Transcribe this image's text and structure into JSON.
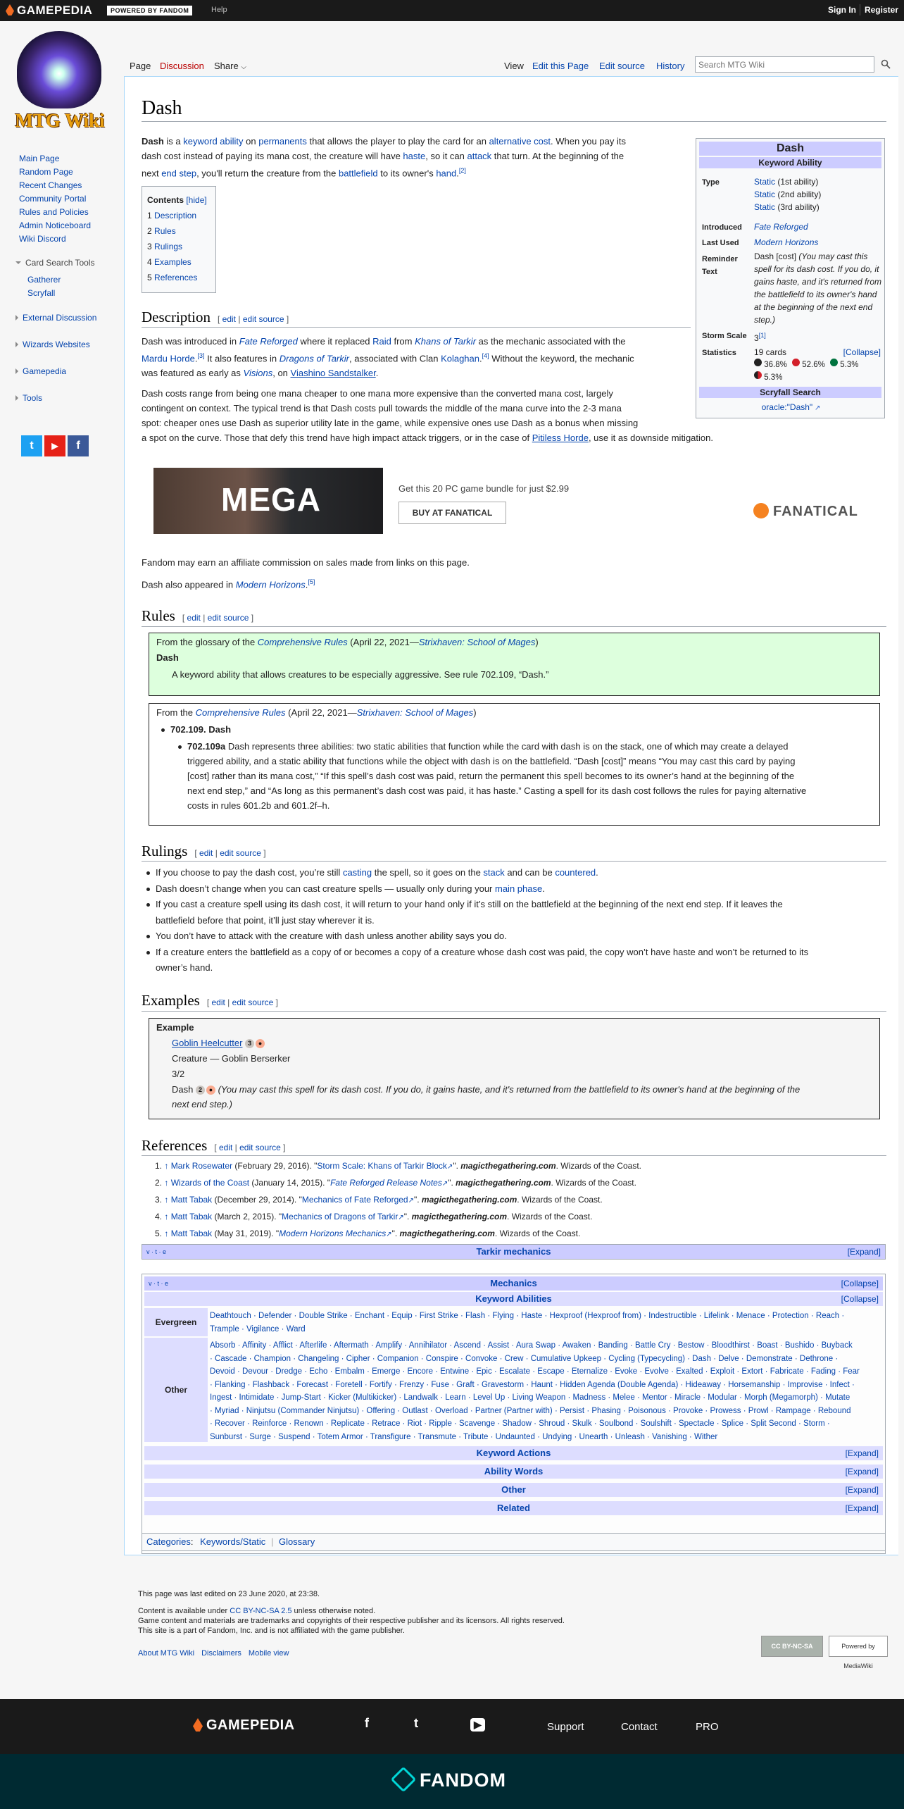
{
  "topbar": {
    "brand": "GAMEPEDIA",
    "powered": "POWERED BY FANDOM",
    "help": "Help",
    "signin": "Sign In",
    "register": "Register"
  },
  "logo": {
    "text": "MTG Wiki"
  },
  "sidebar": {
    "nav": [
      "Main Page",
      "Random Page",
      "Recent Changes",
      "Community Portal",
      "Rules and Policies",
      "Admin Noticeboard",
      "Wiki Discord"
    ],
    "card_search": {
      "title": "Card Search Tools",
      "items": [
        "Gatherer",
        "Scryfall"
      ]
    },
    "sections": [
      "External Discussion",
      "Wizards Websites",
      "Gamepedia",
      "Tools"
    ],
    "social": [
      "t",
      "▶",
      "f"
    ]
  },
  "tabs": {
    "page": "Page",
    "discussion": "Discussion",
    "share": "Share",
    "view": "View",
    "edit": "Edit this Page",
    "edit_source": "Edit source",
    "history": "History"
  },
  "search": {
    "placeholder": "Search MTG Wiki"
  },
  "title": "Dash",
  "intro": {
    "t1": "Dash",
    "t2": " is a ",
    "keyword_ability": "keyword ability",
    "t3": " on ",
    "permanents": "permanents",
    "t4": " that allows the player to play the card for an ",
    "alternative_cost": "alternative cost",
    "t5": ". When you pay its",
    "l2a": "dash cost instead of paying its mana cost, the creature will have ",
    "haste": "haste",
    "l2b": ", so it can ",
    "attack": "attack",
    "l2c": " that turn. At the beginning of the",
    "l3a": "next ",
    "end_step": "end step",
    "l3b": ", you'll return the creature from the ",
    "battlefield": "battlefield",
    "l3c": " to its owner's ",
    "hand": "hand",
    "l3d": ".",
    "ref2": "[2]"
  },
  "toc": {
    "title": "Contents",
    "hide": "[hide]",
    "items": [
      [
        "1",
        "Description"
      ],
      [
        "2",
        "Rules"
      ],
      [
        "3",
        "Rulings"
      ],
      [
        "4",
        "Examples"
      ],
      [
        "5",
        "References"
      ]
    ]
  },
  "edit_links": {
    "edit": "edit",
    "edit_source": "edit source",
    "sep": " | ",
    "open": "[ ",
    "close": " ]"
  },
  "infobox": {
    "title": "Dash",
    "subtitle": "Keyword Ability",
    "type_label": "Type",
    "types": [
      [
        "Static",
        " (1st ability)"
      ],
      [
        "Static",
        " (2nd ability)"
      ],
      [
        "Static",
        " (3rd ability)"
      ]
    ],
    "introduced_label": "Introduced",
    "introduced": "Fate Reforged",
    "last_used_label": "Last Used",
    "last_used": "Modern Horizons",
    "reminder_label": "Reminder",
    "reminder_label2": "Text",
    "reminder": "Dash [cost]",
    "reminder_italic": " (You may cast this spell for its dash cost. If you do, it gains haste, and it's returned from the battlefield to its owner's hand at the beginning of the next end step.)",
    "storm_label": "Storm Scale",
    "storm": "3",
    "storm_ref": "[1]",
    "stats_label": "Statistics",
    "stats_cards": "19 cards",
    "collapse": "[Collapse]",
    "stats": [
      {
        "color": "#222",
        "pct": "36.8%"
      },
      {
        "color": "#d3202a",
        "pct": "52.6%"
      },
      {
        "color": "#00733e",
        "pct": "5.3%"
      }
    ],
    "stats_extra": "5.3%",
    "scryfall_title": "Scryfall Search",
    "scryfall_link": "oracle:\"Dash\""
  },
  "description": {
    "heading": "Description",
    "p1a": "Dash was introduced in ",
    "fate_reforged": "Fate Reforged",
    "p1b": " where it replaced ",
    "raid": "Raid",
    "p1c": " from ",
    "khans": "Khans of Tarkir",
    "p1d": " as the mechanic associated with the",
    "p1e": "Mardu Horde",
    "ref3": "[3]",
    "p1f": " It also features in ",
    "dragons": "Dragons of Tarkir",
    "p1g": ", associated with Clan ",
    "kolaghan": "Kolaghan",
    "ref4": "[4]",
    "p1h": " Without the keyword, the mechanic",
    "p1i": "was featured as early as ",
    "visions": "Visions",
    "p1j": ", on ",
    "viashino": "Viashino Sandstalker",
    "p1k": ".",
    "p2": [
      "Dash costs range from being one mana cheaper to one mana more expensive than the converted mana cost, largely",
      "contingent on context. The typical trend is that Dash costs pull towards the middle of the mana curve into the 2-3 mana",
      "spot: cheaper ones use Dash as superior utility late in the game, while expensive ones use Dash as a bonus when missing"
    ],
    "p2_last_a": "a spot on the curve. Those that defy this trend have high impact attack triggers, or in the case of ",
    "pitiless": "Pitiless Horde",
    "p2_last_b": ", use it as downside mitigation."
  },
  "ad": {
    "image_text": "MEGA",
    "caption": "Get this 20 PC game bundle for just $2.99",
    "button": "BUY AT FANATICAL",
    "brand": "FANATICAL"
  },
  "affiliate": "Fandom may earn an affiliate commission on sales made from links on this page.",
  "also": {
    "a": "Dash also appeared in ",
    "mh": "Modern Horizons",
    "b": ".",
    "ref5": "[5]"
  },
  "rules": {
    "heading": "Rules",
    "glossary_a": "From the glossary of the ",
    "comprehensive": "Comprehensive Rules",
    "glossary_b": " (April 22, 2021—",
    "strixhaven": "Strixhaven: School of Mages",
    "glossary_c": ")",
    "glossary_term": "Dash",
    "glossary_def": "A keyword ability that allows creatures to be especially aggressive. See rule 702.109, “Dash.”",
    "from_a": "From the ",
    "rule_num": "702.109. Dash",
    "rule_sub": "702.109a",
    "rule_text": [
      " Dash represents three abilities: two static abilities that function while the card with dash is on the stack, one of which may create a delayed",
      "triggered ability, and a static ability that functions while the object with dash is on the battlefield. “Dash [cost]” means “You may cast this card by paying",
      "[cost] rather than its mana cost,” “If this spell’s dash cost was paid, return the permanent this spell becomes to its owner’s hand at the beginning of the",
      "next end step,” and “As long as this permanent’s dash cost was paid, it has haste.” Casting a spell for its dash cost follows the rules for paying alternative",
      "costs in rules 601.2b and 601.2f–h."
    ]
  },
  "rulings": {
    "heading": "Rulings",
    "r1a": "If you choose to pay the dash cost, you’re still ",
    "casting": "casting",
    "r1b": " the spell, so it goes on the ",
    "stack": "stack",
    "r1c": " and can be ",
    "countered": "countered",
    "r1d": ".",
    "r2a": "Dash doesn’t change when you can cast creature spells — usually only during your ",
    "main_phase": "main phase",
    "r2b": ".",
    "r3": [
      "If you cast a creature spell using its dash cost, it will return to your hand only if it’s still on the battlefield at the beginning of the next end step. If it leaves the",
      "battlefield before that point, it’ll just stay wherever it is."
    ],
    "r4": "You don’t have to attack with the creature with dash unless another ability says you do.",
    "r5": [
      "If a creature enters the battlefield as a copy of or becomes a copy of a creature whose dash cost was paid, the copy won’t have haste and won’t be returned to its",
      "owner’s hand."
    ]
  },
  "examples": {
    "heading": "Examples",
    "label": "Example",
    "card": "Goblin Heelcutter",
    "cost_generic": "3",
    "type_line": "Creature — Goblin Berserker",
    "pt": "3/2",
    "dash": "Dash ",
    "dash_generic": "2",
    "reminder": [
      " (You may cast this spell for its dash cost. If you do, it gains haste, and it's returned from the battlefield to its owner's hand at the beginning of the",
      "next end step.)"
    ]
  },
  "references": {
    "heading": "References",
    "items": [
      {
        "n": "1.",
        "author": "Mark Rosewater",
        "date": " (February 29, 2016). \"",
        "title": "Storm Scale: Khans of Tarkir Block",
        "site": "magicthegathering.com",
        "pub": ". Wizards of the Coast."
      },
      {
        "n": "2.",
        "author": "Wizards of the Coast",
        "date": " (January 14, 2015). \"",
        "title": "Fate Reforged Release Notes",
        "site": "magicthegathering.com",
        "pub": ". Wizards of the Coast."
      },
      {
        "n": "3.",
        "author": "Matt Tabak",
        "date": " (December 29, 2014). \"",
        "title": "Mechanics of Fate Reforged",
        "site": "magicthegathering.com",
        "pub": ". Wizards of the Coast."
      },
      {
        "n": "4.",
        "author": "Matt Tabak",
        "date": " (March 2, 2015). \"",
        "title": "Mechanics of Dragons of Tarkir",
        "site": "magicthegathering.com",
        "pub": ". Wizards of the Coast."
      },
      {
        "n": "5.",
        "author": "Matt Tabak",
        "date": " (May 31, 2019). \"",
        "title": "Modern Horizons Mechanics",
        "site": "magicthegathering.com",
        "pub": ". Wizards of the Coast."
      }
    ]
  },
  "navboxes": {
    "vte": "v · t · e",
    "tarkir": "Tarkir mechanics",
    "expand": "[Expand]",
    "collapse": "[Collapse]",
    "mechanics": "Mechanics",
    "keyword_abilities": "Keyword Abilities",
    "evergreen_label": "Evergreen",
    "evergreen": [
      "Deathtouch · Defender · Double Strike · Enchant · Equip · First Strike · Flash · Flying · Haste · Hexproof (Hexproof from) · Indestructible · Lifelink · Menace · Protection · Reach ·",
      "Trample · Vigilance · Ward"
    ],
    "other_label": "Other",
    "other": [
      "Absorb · Affinity · Afflict · Afterlife · Aftermath · Amplify · Annihilator · Ascend · Assist · Aura Swap · Awaken · Banding · Battle Cry · Bestow · Bloodthirst · Boast · Bushido · Buyback",
      "· Cascade · Champion · Changeling · Cipher · Companion · Conspire · Convoke · Crew · Cumulative Upkeep · Cycling (Typecycling) · Dash · Delve · Demonstrate · Dethrone ·",
      "Devoid · Devour · Dredge · Echo · Embalm · Emerge · Encore · Entwine · Epic · Escalate · Escape · Eternalize · Evoke · Evolve · Exalted · Exploit · Extort · Fabricate · Fading · Fear",
      "· Flanking · Flashback · Forecast · Foretell · Fortify · Frenzy · Fuse · Graft · Gravestorm · Haunt · Hidden Agenda (Double Agenda) · Hideaway · Horsemanship · Improvise · Infect ·",
      "Ingest · Intimidate · Jump-Start · Kicker (Multikicker) · Landwalk · Learn · Level Up · Living Weapon · Madness · Melee · Mentor · Miracle · Modular · Morph (Megamorph) · Mutate",
      "· Myriad · Ninjutsu (Commander Ninjutsu) · Offering · Outlast · Overload · Partner (Partner with) · Persist · Phasing · Poisonous · Provoke · Prowess · Prowl · Rampage · Rebound",
      "· Recover · Reinforce · Renown · Replicate · Retrace · Riot · Ripple · Scavenge · Shadow · Shroud · Skulk · Soulbond · Soulshift · Spectacle · Splice · Split Second · Storm ·",
      "Sunburst · Surge · Suspend · Totem Armor · Transfigure · Transmute · Tribute · Undaunted · Undying · Unearth · Unleash · Vanishing · Wither"
    ],
    "keyword_actions": "Keyword Actions",
    "ability_words": "Ability Words",
    "other_section": "Other",
    "related": "Related"
  },
  "categories": {
    "label": "Categories",
    "items": [
      "Keywords/Static",
      "Glossary"
    ]
  },
  "footer": {
    "last_edited": "This page was last edited on 23 June 2020, at 23:38.",
    "content_a": "Content is available under ",
    "license": "CC BY-NC-SA 2.5",
    "content_b": " unless otherwise noted.",
    "trademark": "Game content and materials are trademarks and copyrights of their respective publisher and its licensors. All rights reserved.",
    "affiliation": "This site is a part of Fandom, Inc. and is not affiliated with the game publisher.",
    "links": [
      "About MTG Wiki",
      "Disclaimers",
      "Mobile view"
    ],
    "cc_badge": "CC BY-NC-SA",
    "mw_badge": "Powered by MediaWiki"
  },
  "bottombar": {
    "brand": "GAMEPEDIA",
    "links": [
      "Support",
      "Contact",
      "PRO"
    ],
    "icons": [
      "f",
      "t",
      "▶"
    ]
  },
  "fandombar": {
    "brand": "FANDOM"
  },
  "colors": {
    "accent": "#0645ad",
    "navbox_header": "#ccccff",
    "glossary_bg": "#ddffdd",
    "dark_bar": "#1a1a1a",
    "fandom_bar": "#002a32"
  }
}
